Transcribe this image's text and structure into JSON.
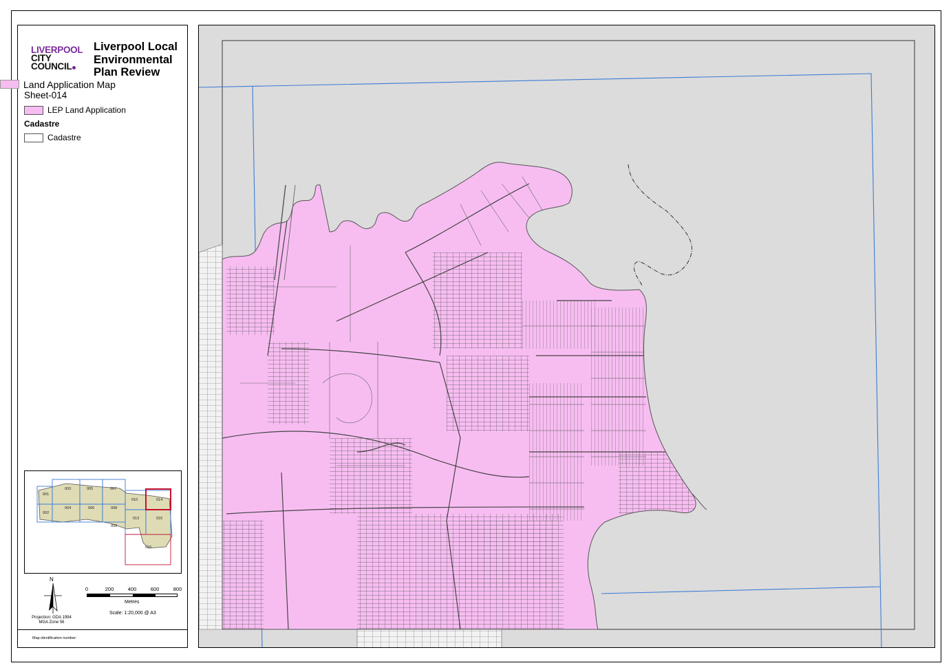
{
  "header": {
    "logo_line1": "LIVERPOOL",
    "logo_line2": "CITY",
    "logo_line3": "COUNCIL",
    "title_line1": "Liverpool Local",
    "title_line2": "Environmental",
    "title_line3": "Plan Review",
    "map_name": "Land Application Map",
    "sheet": "Sheet-014"
  },
  "legend": {
    "items": [
      {
        "label": "LEP Land Application",
        "fill": "#f7bdf1",
        "stroke": "#555555"
      }
    ],
    "group_heading": "Cadastre",
    "group_items": [
      {
        "label": "Cadastre",
        "fill": "#ffffff",
        "stroke": "#555555"
      }
    ]
  },
  "index_map": {
    "sheets": [
      "001",
      "002",
      "003",
      "004",
      "005",
      "006",
      "007",
      "008",
      "009",
      "010",
      "011",
      "012",
      "013",
      "014",
      "015",
      "016"
    ],
    "current_sheet": "014",
    "tile_color": "#3a7bd5",
    "current_color": "#c8102e",
    "area_fill": "#dfdcb5"
  },
  "north_arrow": {
    "label": "N"
  },
  "scale_bar": {
    "ticks": [
      "0",
      "200",
      "400",
      "600",
      "800"
    ],
    "units": "Metres",
    "scale_text": "Scale: 1:20,000 @ A3"
  },
  "projection": {
    "line1": "Projection: GDA 1994",
    "line2": "MGA Zone 56"
  },
  "map_id_label": "Map identification number:",
  "colors": {
    "land_application": "#f7bdf1",
    "background_area": "#dcdcdc",
    "sheet_grid": "#3a7bd5",
    "cadastre_line": "#444444"
  }
}
